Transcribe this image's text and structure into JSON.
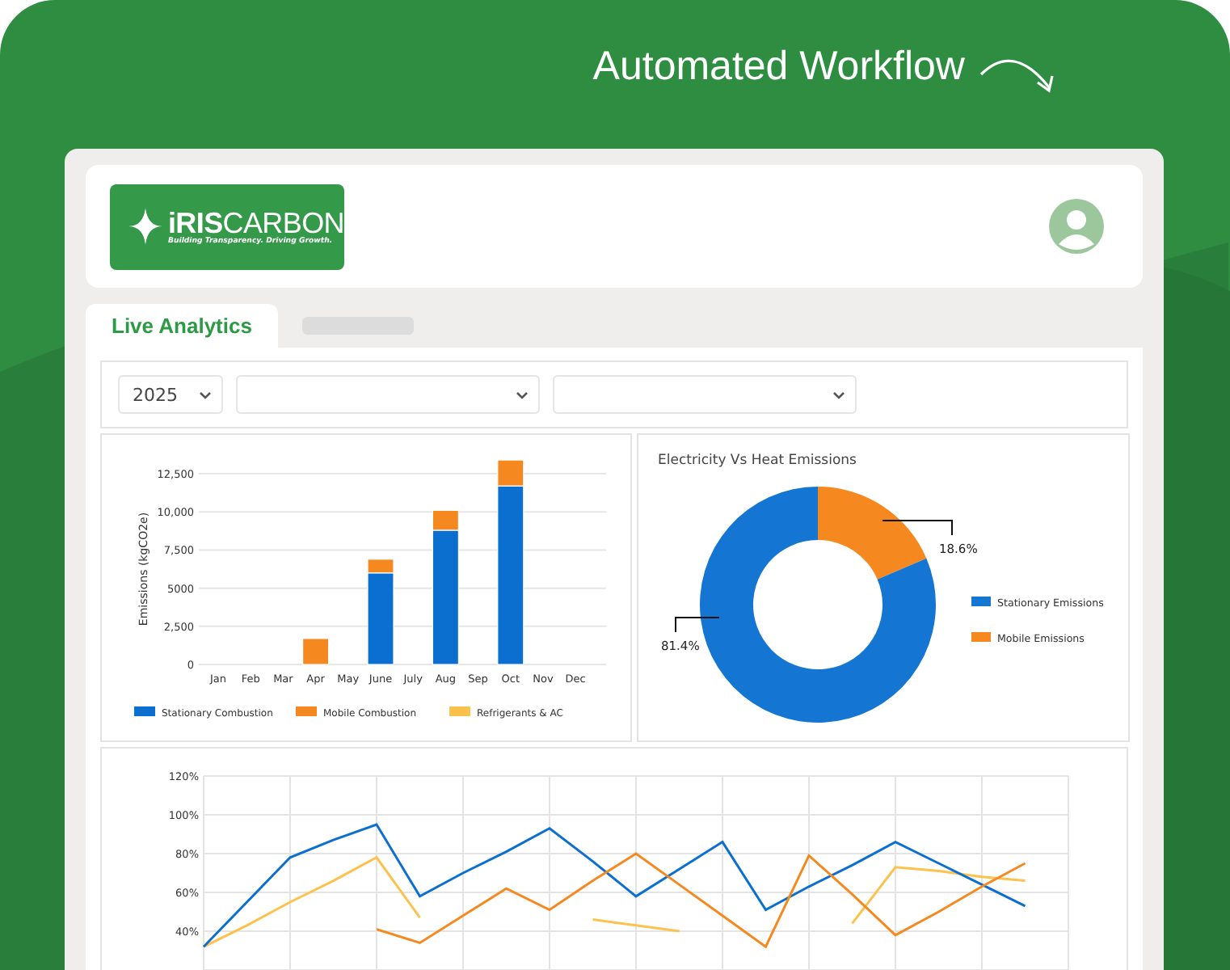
{
  "header": {
    "title": "Automated Workflow"
  },
  "logo": {
    "name": "**iRIS**CARBON",
    "tagline": "Building Transparency. Driving Growth."
  },
  "tabs": [
    {
      "label": "Live Analytics",
      "selected": true
    },
    {
      "selected": false
    }
  ],
  "filters": [
    {
      "kind": "year",
      "value": "2025"
    },
    {
      "kind": "blank"
    },
    {
      "kind": "blank"
    }
  ],
  "emissions_chart": {
    "chart_data": {
      "type": "bar",
      "stacked": true,
      "grid": true,
      "legend": true,
      "ylabel": "Emissions (kgCO2e)",
      "categories": [
        "Jan",
        "Feb",
        "Mar",
        "Apr",
        "May",
        "June",
        "July",
        "Aug",
        "Sep",
        "Oct",
        "Nov",
        "Dec"
      ],
      "ylim": [
        0,
        13500
      ],
      "yticks": [
        {
          "value": 0,
          "label": "0"
        },
        {
          "value": 2500,
          "label": "2,500"
        },
        {
          "value": 5000,
          "label": "5000"
        },
        {
          "value": 7500,
          "label": "7,500"
        },
        {
          "value": 10000,
          "label": "10,000"
        },
        {
          "value": 12500,
          "label": "12,500"
        }
      ],
      "series": [
        {
          "name": "Stationary Combustion",
          "color": "#0b6fd0",
          "values": [
            0,
            0,
            0,
            0,
            0,
            6000,
            0,
            8800,
            0,
            11700,
            0,
            0
          ]
        },
        {
          "name": "Mobile Combustion",
          "color": "#f5891f",
          "values": [
            0,
            0,
            0,
            1700,
            0,
            900,
            0,
            1300,
            0,
            1700,
            0,
            0
          ]
        },
        {
          "name": "Refrigerants & AC",
          "color": "#fdc24e",
          "values": [
            0,
            0,
            0,
            0,
            0,
            0,
            0,
            0,
            0,
            0,
            0,
            0
          ]
        }
      ]
    }
  },
  "heat_chart": {
    "chart_data": {
      "type": "donut",
      "title": "Electricity Vs Heat Emissions",
      "legend": true,
      "categories": [
        "Stationary Emissions",
        "Mobile Emissions"
      ],
      "values": [
        81.4,
        18.6
      ],
      "colors": [
        "#1476d2",
        "#f5891f"
      ],
      "value_labels": [
        "81.4%",
        "18.6%"
      ]
    }
  },
  "trend_chart": {
    "chart_data": {
      "type": "line",
      "grid": true,
      "ylim": [
        0,
        120
      ],
      "yticks": [
        {
          "value": 40,
          "label": "40%"
        },
        {
          "value": 60,
          "label": "60%"
        },
        {
          "value": 80,
          "label": "80%"
        },
        {
          "value": 100,
          "label": "100%"
        },
        {
          "value": 120,
          "label": "120%"
        }
      ],
      "categories": [
        null,
        null,
        null,
        null,
        null,
        null,
        null,
        null,
        null,
        null,
        null,
        null,
        null,
        null,
        null,
        null,
        null,
        null,
        null,
        null
      ],
      "series": [
        {
          "color": "#fdc24e",
          "values": [
            32,
            43,
            55,
            66,
            78,
            47,
            null,
            null,
            null,
            46,
            43,
            40,
            null,
            null,
            null,
            44,
            73,
            71,
            68,
            66
          ]
        },
        {
          "color": "#0b6fd0",
          "values": [
            32,
            55,
            78,
            87,
            95,
            58,
            70,
            81,
            93,
            76,
            58,
            72,
            86,
            51,
            63,
            74,
            86,
            75,
            64,
            53
          ]
        },
        {
          "color": "#f5891f",
          "values": [
            null,
            null,
            null,
            null,
            41,
            34,
            48,
            62,
            51,
            66,
            80,
            64,
            48,
            32,
            79,
            59,
            38,
            50,
            63,
            75
          ]
        }
      ]
    }
  }
}
